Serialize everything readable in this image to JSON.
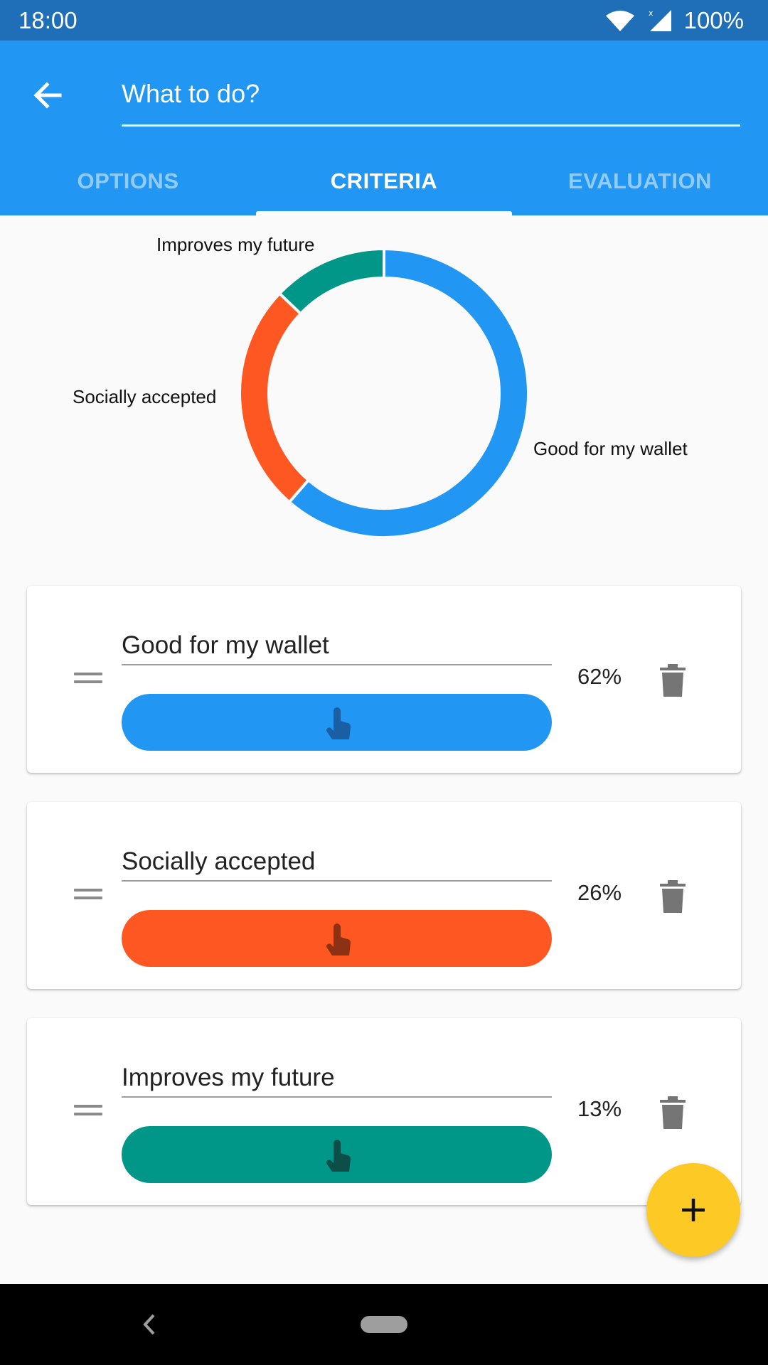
{
  "status": {
    "time": "18:00",
    "battery": "100%",
    "icons": [
      "wifi-icon",
      "signal-icon",
      "battery-text"
    ]
  },
  "app_bar": {
    "back_icon": "arrow-back-icon",
    "title_value": "What to do?",
    "tabs": [
      {
        "label": "OPTIONS",
        "active": false
      },
      {
        "label": "CRITERIA",
        "active": true
      },
      {
        "label": "EVALUATION",
        "active": false
      }
    ]
  },
  "chart_data": {
    "type": "pie",
    "style": "donut",
    "categories": [
      "Good for my wallet",
      "Socially accepted",
      "Improves my future"
    ],
    "values": [
      62,
      26,
      13
    ],
    "colors": [
      "#2196f3",
      "#ff5722",
      "#009688"
    ],
    "title": ""
  },
  "criteria": [
    {
      "name": "Good for my wallet",
      "weight": "62%",
      "weight_value": 62,
      "color": "#2196f3",
      "handle_color": "#1a5fa3"
    },
    {
      "name": "Socially accepted",
      "weight": "26%",
      "weight_value": 26,
      "color": "#ff5722",
      "handle_color": "#8d3114"
    },
    {
      "name": "Improves my future",
      "weight": "13%",
      "weight_value": 13,
      "color": "#009688",
      "handle_color": "#0d4f48"
    }
  ],
  "icons": {
    "drag": "drag-handle-icon",
    "delete": "trash-icon",
    "slider_handle": "touch-icon",
    "fab": "plus-icon"
  },
  "nav": {
    "back_icon": "nav-back-icon",
    "home_icon": "home-pill-icon"
  }
}
